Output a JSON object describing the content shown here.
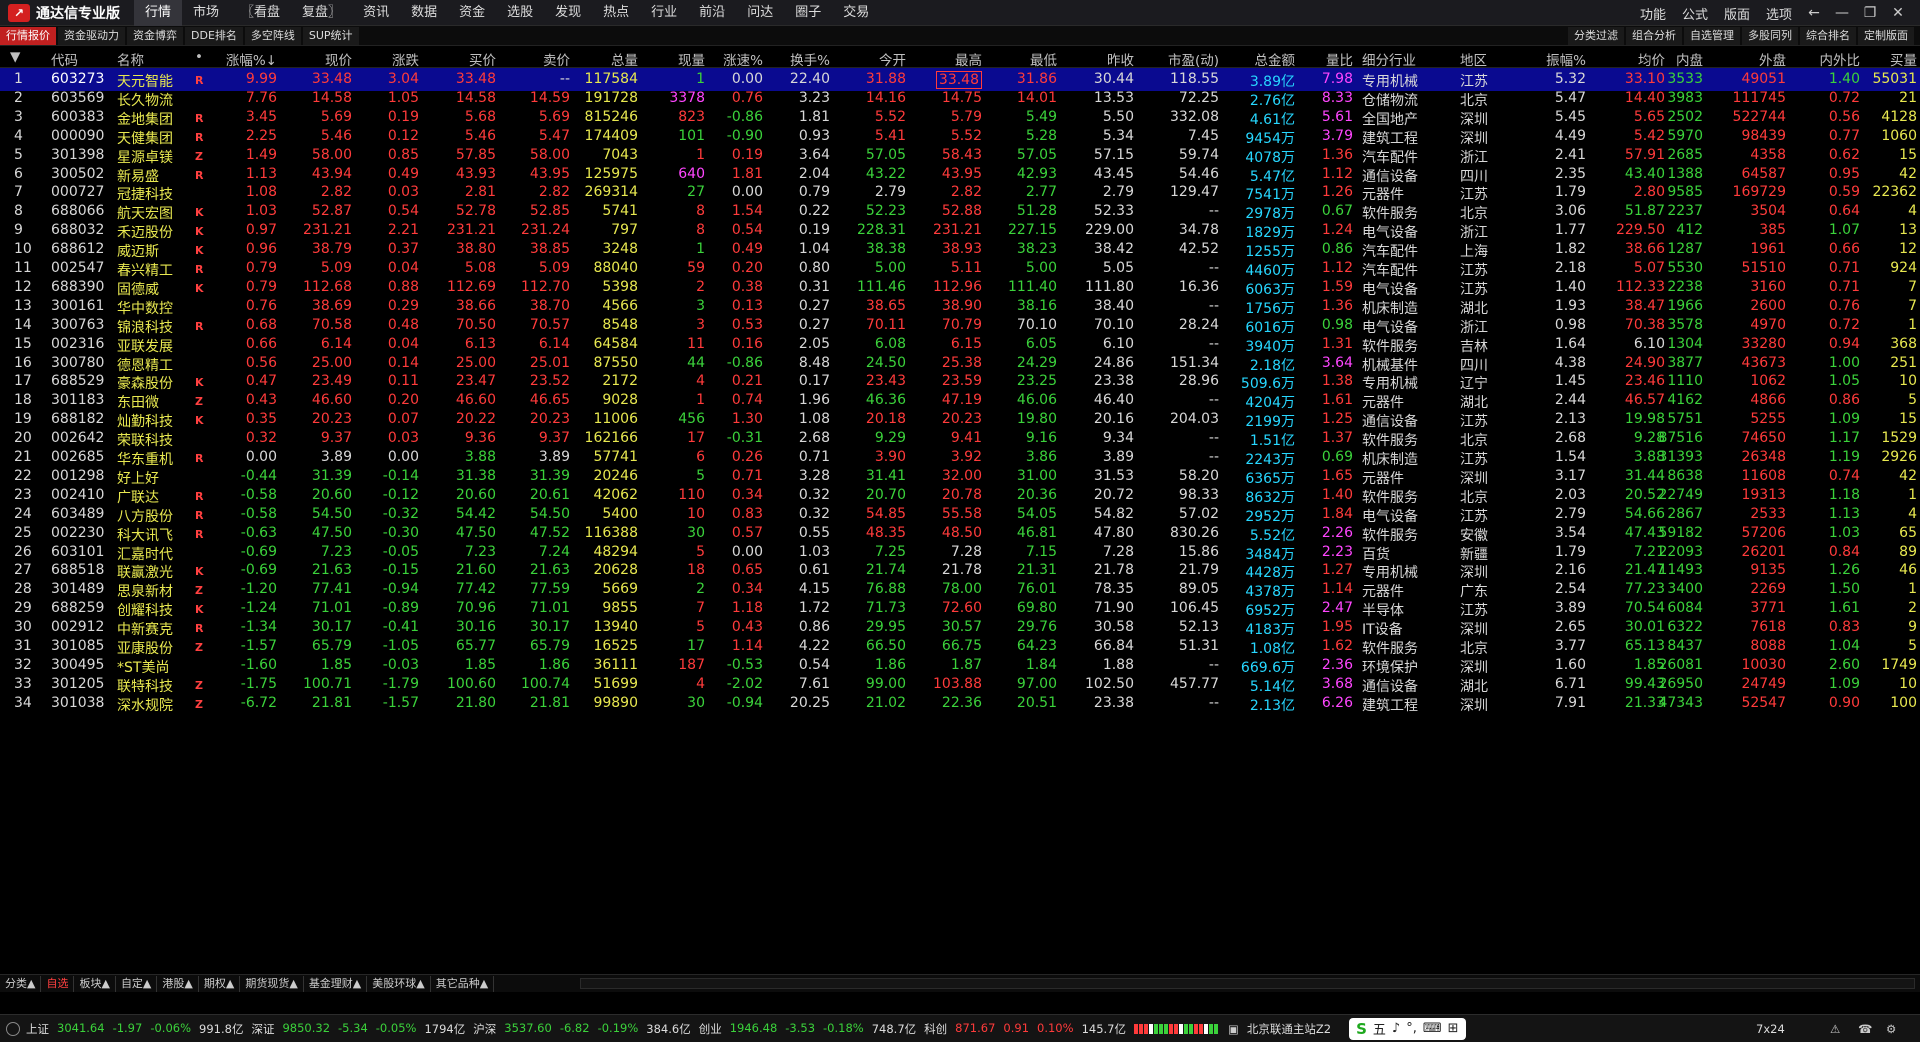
{
  "app": {
    "name": "通达信专业版"
  },
  "menu": [
    "行情",
    "市场",
    "〖看盘",
    "复盘〗",
    "资讯",
    "数据",
    "资金",
    "选股",
    "发现",
    "热点",
    "行业",
    "前沿",
    "问达",
    "圈子",
    "交易"
  ],
  "menu_active": 0,
  "right_menu": [
    "功能",
    "公式",
    "版面",
    "选项"
  ],
  "subtabs": [
    "行情报价",
    "资金驱动力",
    "资金博弈",
    "DDE排名",
    "多空阵线",
    "SUP统计"
  ],
  "subtabs_right": [
    "分类过滤",
    "组合分析",
    "自选管理",
    "多股同列",
    "综合排名",
    "定制版面"
  ],
  "columns": [
    "",
    "代码",
    "名称",
    "•",
    "涨幅%↓",
    "现价",
    "涨跌",
    "买价",
    "卖价",
    "总量",
    "现量",
    "涨速%",
    "换手%",
    "今开",
    "最高",
    "最低",
    "昨收",
    "市盈(动)",
    "总金额",
    "量比",
    "细分行业",
    "地区",
    "振幅%",
    "均价",
    "内盘",
    "外盘",
    "内外比",
    "买量"
  ],
  "rows": [
    [
      "1",
      "603273",
      "天元智能",
      "R",
      "9.99",
      "33.48",
      "3.04",
      "33.48",
      "--",
      "117584",
      "1",
      "0.00",
      "22.40",
      "31.88",
      "33.48",
      "31.86",
      "30.44",
      "118.55",
      "3.89亿",
      "7.98",
      "专用机械",
      "江苏",
      "5.32",
      "33.10",
      "3533",
      "49051",
      "1.40",
      "55031"
    ],
    [
      "2",
      "603569",
      "长久物流",
      "",
      "7.76",
      "14.58",
      "1.05",
      "14.58",
      "14.59",
      "191728",
      "3378",
      "0.76",
      "3.23",
      "14.16",
      "14.75",
      "14.01",
      "13.53",
      "72.25",
      "2.76亿",
      "8.33",
      "仓储物流",
      "北京",
      "5.47",
      "14.40",
      "3983",
      "111745",
      "0.72",
      "21"
    ],
    [
      "3",
      "600383",
      "金地集团",
      "R",
      "3.45",
      "5.69",
      "0.19",
      "5.68",
      "5.69",
      "815246",
      "823",
      "-0.86",
      "1.81",
      "5.52",
      "5.79",
      "5.49",
      "5.50",
      "332.08",
      "4.61亿",
      "5.61",
      "全国地产",
      "深圳",
      "5.45",
      "5.65",
      "2502",
      "522744",
      "0.56",
      "4128"
    ],
    [
      "4",
      "000090",
      "天健集团",
      "R",
      "2.25",
      "5.46",
      "0.12",
      "5.46",
      "5.47",
      "174409",
      "101",
      "-0.90",
      "0.93",
      "5.41",
      "5.52",
      "5.28",
      "5.34",
      "7.45",
      "9454万",
      "3.79",
      "建筑工程",
      "深圳",
      "4.49",
      "5.42",
      "5970",
      "98439",
      "0.77",
      "1060"
    ],
    [
      "5",
      "301398",
      "星源卓镁",
      "Z",
      "1.49",
      "58.00",
      "0.85",
      "57.85",
      "58.00",
      "7043",
      "1",
      "0.19",
      "3.64",
      "57.05",
      "58.43",
      "57.05",
      "57.15",
      "59.74",
      "4078万",
      "1.36",
      "汽车配件",
      "浙江",
      "2.41",
      "57.91",
      "2685",
      "4358",
      "0.62",
      "15"
    ],
    [
      "6",
      "300502",
      "新易盛",
      "R",
      "1.13",
      "43.94",
      "0.49",
      "43.93",
      "43.95",
      "125975",
      "640",
      "1.81",
      "2.04",
      "43.22",
      "43.95",
      "42.93",
      "43.45",
      "54.46",
      "5.47亿",
      "1.12",
      "通信设备",
      "四川",
      "2.35",
      "43.40",
      "1388",
      "64587",
      "0.95",
      "42"
    ],
    [
      "7",
      "000727",
      "冠捷科技",
      "",
      "1.08",
      "2.82",
      "0.03",
      "2.81",
      "2.82",
      "269314",
      "27",
      "0.00",
      "0.79",
      "2.79",
      "2.82",
      "2.77",
      "2.79",
      "129.47",
      "7541万",
      "1.26",
      "元器件",
      "江苏",
      "1.79",
      "2.80",
      "9585",
      "169729",
      "0.59",
      "22362"
    ],
    [
      "8",
      "688066",
      "航天宏图",
      "K",
      "1.03",
      "52.87",
      "0.54",
      "52.78",
      "52.85",
      "5741",
      "8",
      "1.54",
      "0.22",
      "52.23",
      "52.88",
      "51.28",
      "52.33",
      "--",
      "2978万",
      "0.67",
      "软件服务",
      "北京",
      "3.06",
      "51.87",
      "2237",
      "3504",
      "0.64",
      "4"
    ],
    [
      "9",
      "688032",
      "禾迈股份",
      "K",
      "0.97",
      "231.21",
      "2.21",
      "231.21",
      "231.24",
      "797",
      "8",
      "0.54",
      "0.19",
      "228.31",
      "231.21",
      "227.15",
      "229.00",
      "34.78",
      "1829万",
      "1.24",
      "电气设备",
      "浙江",
      "1.77",
      "229.50",
      "412",
      "385",
      "1.07",
      "13"
    ],
    [
      "10",
      "688612",
      "威迈斯",
      "K",
      "0.96",
      "38.79",
      "0.37",
      "38.80",
      "38.85",
      "3248",
      "1",
      "0.49",
      "1.04",
      "38.38",
      "38.93",
      "38.23",
      "38.42",
      "42.52",
      "1255万",
      "0.86",
      "汽车配件",
      "上海",
      "1.82",
      "38.66",
      "1287",
      "1961",
      "0.66",
      "12"
    ],
    [
      "11",
      "002547",
      "春兴精工",
      "R",
      "0.79",
      "5.09",
      "0.04",
      "5.08",
      "5.09",
      "88040",
      "59",
      "0.20",
      "0.80",
      "5.00",
      "5.11",
      "5.00",
      "5.05",
      "--",
      "4460万",
      "1.12",
      "汽车配件",
      "江苏",
      "2.18",
      "5.07",
      "5530",
      "51510",
      "0.71",
      "924"
    ],
    [
      "12",
      "688390",
      "固德威",
      "K",
      "0.79",
      "112.68",
      "0.88",
      "112.69",
      "112.70",
      "5398",
      "2",
      "0.38",
      "0.31",
      "111.46",
      "112.96",
      "111.40",
      "111.80",
      "16.36",
      "6063万",
      "1.59",
      "电气设备",
      "江苏",
      "1.40",
      "112.33",
      "2238",
      "3160",
      "0.71",
      "7"
    ],
    [
      "13",
      "300161",
      "华中数控",
      "",
      "0.76",
      "38.69",
      "0.29",
      "38.66",
      "38.70",
      "4566",
      "3",
      "0.13",
      "0.27",
      "38.65",
      "38.90",
      "38.16",
      "38.40",
      "--",
      "1756万",
      "1.36",
      "机床制造",
      "湖北",
      "1.93",
      "38.47",
      "1966",
      "2600",
      "0.76",
      "7"
    ],
    [
      "14",
      "300763",
      "锦浪科技",
      "R",
      "0.68",
      "70.58",
      "0.48",
      "70.50",
      "70.57",
      "8548",
      "3",
      "0.53",
      "0.27",
      "70.11",
      "70.79",
      "70.10",
      "70.10",
      "28.24",
      "6016万",
      "0.98",
      "电气设备",
      "浙江",
      "0.98",
      "70.38",
      "3578",
      "4970",
      "0.72",
      "1"
    ],
    [
      "15",
      "002316",
      "亚联发展",
      "",
      "0.66",
      "6.14",
      "0.04",
      "6.13",
      "6.14",
      "64584",
      "11",
      "0.16",
      "2.05",
      "6.08",
      "6.15",
      "6.05",
      "6.10",
      "--",
      "3940万",
      "1.31",
      "软件服务",
      "吉林",
      "1.64",
      "6.10",
      "1304",
      "33280",
      "0.94",
      "368"
    ],
    [
      "16",
      "300780",
      "德恩精工",
      "",
      "0.56",
      "25.00",
      "0.14",
      "25.00",
      "25.01",
      "87550",
      "44",
      "-0.86",
      "8.48",
      "24.50",
      "25.38",
      "24.29",
      "24.86",
      "151.34",
      "2.18亿",
      "3.64",
      "机械基件",
      "四川",
      "4.38",
      "24.90",
      "3877",
      "43673",
      "1.00",
      "251"
    ],
    [
      "17",
      "688529",
      "豪森股份",
      "K",
      "0.47",
      "23.49",
      "0.11",
      "23.47",
      "23.52",
      "2172",
      "4",
      "0.21",
      "0.17",
      "23.43",
      "23.59",
      "23.25",
      "23.38",
      "28.96",
      "509.6万",
      "1.38",
      "专用机械",
      "辽宁",
      "1.45",
      "23.46",
      "1110",
      "1062",
      "1.05",
      "10"
    ],
    [
      "18",
      "301183",
      "东田微",
      "Z",
      "0.43",
      "46.60",
      "0.20",
      "46.60",
      "46.65",
      "9028",
      "1",
      "0.74",
      "1.96",
      "46.36",
      "47.19",
      "46.06",
      "46.40",
      "--",
      "4204万",
      "1.61",
      "元器件",
      "湖北",
      "2.44",
      "46.57",
      "4162",
      "4866",
      "0.86",
      "5"
    ],
    [
      "19",
      "688182",
      "灿勤科技",
      "K",
      "0.35",
      "20.23",
      "0.07",
      "20.22",
      "20.23",
      "11006",
      "456",
      "1.30",
      "1.08",
      "20.18",
      "20.23",
      "19.80",
      "20.16",
      "204.03",
      "2199万",
      "1.25",
      "通信设备",
      "江苏",
      "2.13",
      "19.98",
      "5751",
      "5255",
      "1.09",
      "15"
    ],
    [
      "20",
      "002642",
      "荣联科技",
      "",
      "0.32",
      "9.37",
      "0.03",
      "9.36",
      "9.37",
      "162166",
      "17",
      "-0.31",
      "2.68",
      "9.29",
      "9.41",
      "9.16",
      "9.34",
      "--",
      "1.51亿",
      "1.37",
      "软件服务",
      "北京",
      "2.68",
      "9.28",
      "87516",
      "74650",
      "1.17",
      "1529"
    ],
    [
      "21",
      "002685",
      "华东重机",
      "R",
      "0.00",
      "3.89",
      "0.00",
      "3.88",
      "3.89",
      "57741",
      "6",
      "0.26",
      "0.71",
      "3.90",
      "3.92",
      "3.86",
      "3.89",
      "--",
      "2243万",
      "0.69",
      "机床制造",
      "江苏",
      "1.54",
      "3.88",
      "31393",
      "26348",
      "1.19",
      "2926"
    ],
    [
      "22",
      "001298",
      "好上好",
      "",
      "-0.44",
      "31.39",
      "-0.14",
      "31.38",
      "31.39",
      "20246",
      "5",
      "0.71",
      "3.28",
      "31.41",
      "32.00",
      "31.00",
      "31.53",
      "58.20",
      "6365万",
      "1.65",
      "元器件",
      "深圳",
      "3.17",
      "31.44",
      "8638",
      "11608",
      "0.74",
      "42"
    ],
    [
      "23",
      "002410",
      "广联达",
      "R",
      "-0.58",
      "20.60",
      "-0.12",
      "20.60",
      "20.61",
      "42062",
      "110",
      "0.34",
      "0.32",
      "20.70",
      "20.78",
      "20.36",
      "20.72",
      "98.33",
      "8632万",
      "1.40",
      "软件服务",
      "北京",
      "2.03",
      "20.52",
      "22749",
      "19313",
      "1.18",
      "1"
    ],
    [
      "24",
      "603489",
      "八方股份",
      "R",
      "-0.58",
      "54.50",
      "-0.32",
      "54.42",
      "54.50",
      "5400",
      "10",
      "0.83",
      "0.32",
      "54.85",
      "55.58",
      "54.05",
      "54.82",
      "57.02",
      "2952万",
      "1.84",
      "电气设备",
      "江苏",
      "2.79",
      "54.66",
      "2867",
      "2533",
      "1.13",
      "4"
    ],
    [
      "25",
      "002230",
      "科大讯飞",
      "R",
      "-0.63",
      "47.50",
      "-0.30",
      "47.50",
      "47.52",
      "116388",
      "30",
      "0.57",
      "0.55",
      "48.35",
      "48.50",
      "46.81",
      "47.80",
      "830.26",
      "5.52亿",
      "2.26",
      "软件服务",
      "安徽",
      "3.54",
      "47.43",
      "59182",
      "57206",
      "1.03",
      "65"
    ],
    [
      "26",
      "603101",
      "汇嘉时代",
      "",
      "-0.69",
      "7.23",
      "-0.05",
      "7.23",
      "7.24",
      "48294",
      "5",
      "0.00",
      "1.03",
      "7.25",
      "7.28",
      "7.15",
      "7.28",
      "15.86",
      "3484万",
      "2.23",
      "百货",
      "新疆",
      "1.79",
      "7.21",
      "22093",
      "26201",
      "0.84",
      "89"
    ],
    [
      "27",
      "688518",
      "联赢激光",
      "K",
      "-0.69",
      "21.63",
      "-0.15",
      "21.60",
      "21.63",
      "20628",
      "18",
      "0.65",
      "0.61",
      "21.74",
      "21.78",
      "21.31",
      "21.78",
      "21.79",
      "4428万",
      "1.27",
      "专用机械",
      "深圳",
      "2.16",
      "21.47",
      "11493",
      "9135",
      "1.26",
      "46"
    ],
    [
      "28",
      "301489",
      "思泉新材",
      "Z",
      "-1.20",
      "77.41",
      "-0.94",
      "77.42",
      "77.59",
      "5669",
      "2",
      "0.34",
      "4.15",
      "76.88",
      "78.00",
      "76.01",
      "78.35",
      "89.05",
      "4378万",
      "1.14",
      "元器件",
      "广东",
      "2.54",
      "77.23",
      "3400",
      "2269",
      "1.50",
      "1"
    ],
    [
      "29",
      "688259",
      "创耀科技",
      "K",
      "-1.24",
      "71.01",
      "-0.89",
      "70.96",
      "71.01",
      "9855",
      "7",
      "1.18",
      "1.72",
      "71.73",
      "72.60",
      "69.80",
      "71.90",
      "106.45",
      "6952万",
      "2.47",
      "半导体",
      "江苏",
      "3.89",
      "70.54",
      "6084",
      "3771",
      "1.61",
      "2"
    ],
    [
      "30",
      "002912",
      "中新赛克",
      "R",
      "-1.34",
      "30.17",
      "-0.41",
      "30.16",
      "30.17",
      "13940",
      "5",
      "0.43",
      "0.86",
      "29.95",
      "30.57",
      "29.76",
      "30.58",
      "52.13",
      "4183万",
      "1.95",
      "IT设备",
      "深圳",
      "2.65",
      "30.01",
      "6322",
      "7618",
      "0.83",
      "9"
    ],
    [
      "31",
      "301085",
      "亚康股份",
      "Z",
      "-1.57",
      "65.79",
      "-1.05",
      "65.77",
      "65.79",
      "16525",
      "17",
      "1.14",
      "4.22",
      "66.50",
      "66.75",
      "64.23",
      "66.84",
      "51.31",
      "1.08亿",
      "1.62",
      "软件服务",
      "北京",
      "3.77",
      "65.13",
      "8437",
      "8088",
      "1.04",
      "5"
    ],
    [
      "32",
      "300495",
      "*ST美尚",
      "",
      "-1.60",
      "1.85",
      "-0.03",
      "1.85",
      "1.86",
      "36111",
      "187",
      "-0.53",
      "0.54",
      "1.86",
      "1.87",
      "1.84",
      "1.88",
      "--",
      "669.6万",
      "2.36",
      "环境保护",
      "深圳",
      "1.60",
      "1.85",
      "26081",
      "10030",
      "2.60",
      "1749"
    ],
    [
      "33",
      "301205",
      "联特科技",
      "Z",
      "-1.75",
      "100.71",
      "-1.79",
      "100.60",
      "100.74",
      "51699",
      "4",
      "-2.02",
      "7.61",
      "99.00",
      "103.88",
      "97.00",
      "102.50",
      "457.77",
      "5.14亿",
      "3.68",
      "通信设备",
      "湖北",
      "6.71",
      "99.43",
      "26950",
      "24749",
      "1.09",
      "10"
    ],
    [
      "34",
      "301038",
      "深水规院",
      "Z",
      "-6.72",
      "21.81",
      "-1.57",
      "21.80",
      "21.81",
      "99890",
      "30",
      "-0.94",
      "20.25",
      "21.02",
      "22.36",
      "20.51",
      "23.38",
      "--",
      "2.13亿",
      "6.26",
      "建筑工程",
      "深圳",
      "7.91",
      "21.33",
      "47343",
      "52547",
      "0.90",
      "100"
    ]
  ],
  "bottom_tabs": [
    "分类▲",
    "自选",
    "板块▲",
    "自定▲",
    "港股▲",
    "期权▲",
    "期货现货▲",
    "基金理财▲",
    "美股环球▲",
    "其它品种▲"
  ],
  "bottom_tabs_active": 1,
  "status": [
    {
      "label": "上证",
      "value": "3041.64",
      "chg": "-1.97",
      "pct": "-0.06%",
      "amt": "991.8亿"
    },
    {
      "label": "深证",
      "value": "9850.32",
      "chg": "-5.34",
      "pct": "-0.05%",
      "amt": "1794亿"
    },
    {
      "label": "沪深",
      "value": "3537.60",
      "chg": "-6.82",
      "pct": "-0.19%",
      "amt": "384.6亿"
    },
    {
      "label": "创业",
      "value": "1946.48",
      "chg": "-3.53",
      "pct": "-0.18%",
      "amt": "748.7亿"
    },
    {
      "label": "科创",
      "value": "871.67",
      "chg": "0.91",
      "pct": "0.10%",
      "amt": "145.7亿"
    }
  ],
  "station": "北京联通主站Z2",
  "ime": [
    "S",
    "五",
    "♪",
    "°,",
    "⌨",
    "⊞"
  ],
  "time_label": "7x24"
}
